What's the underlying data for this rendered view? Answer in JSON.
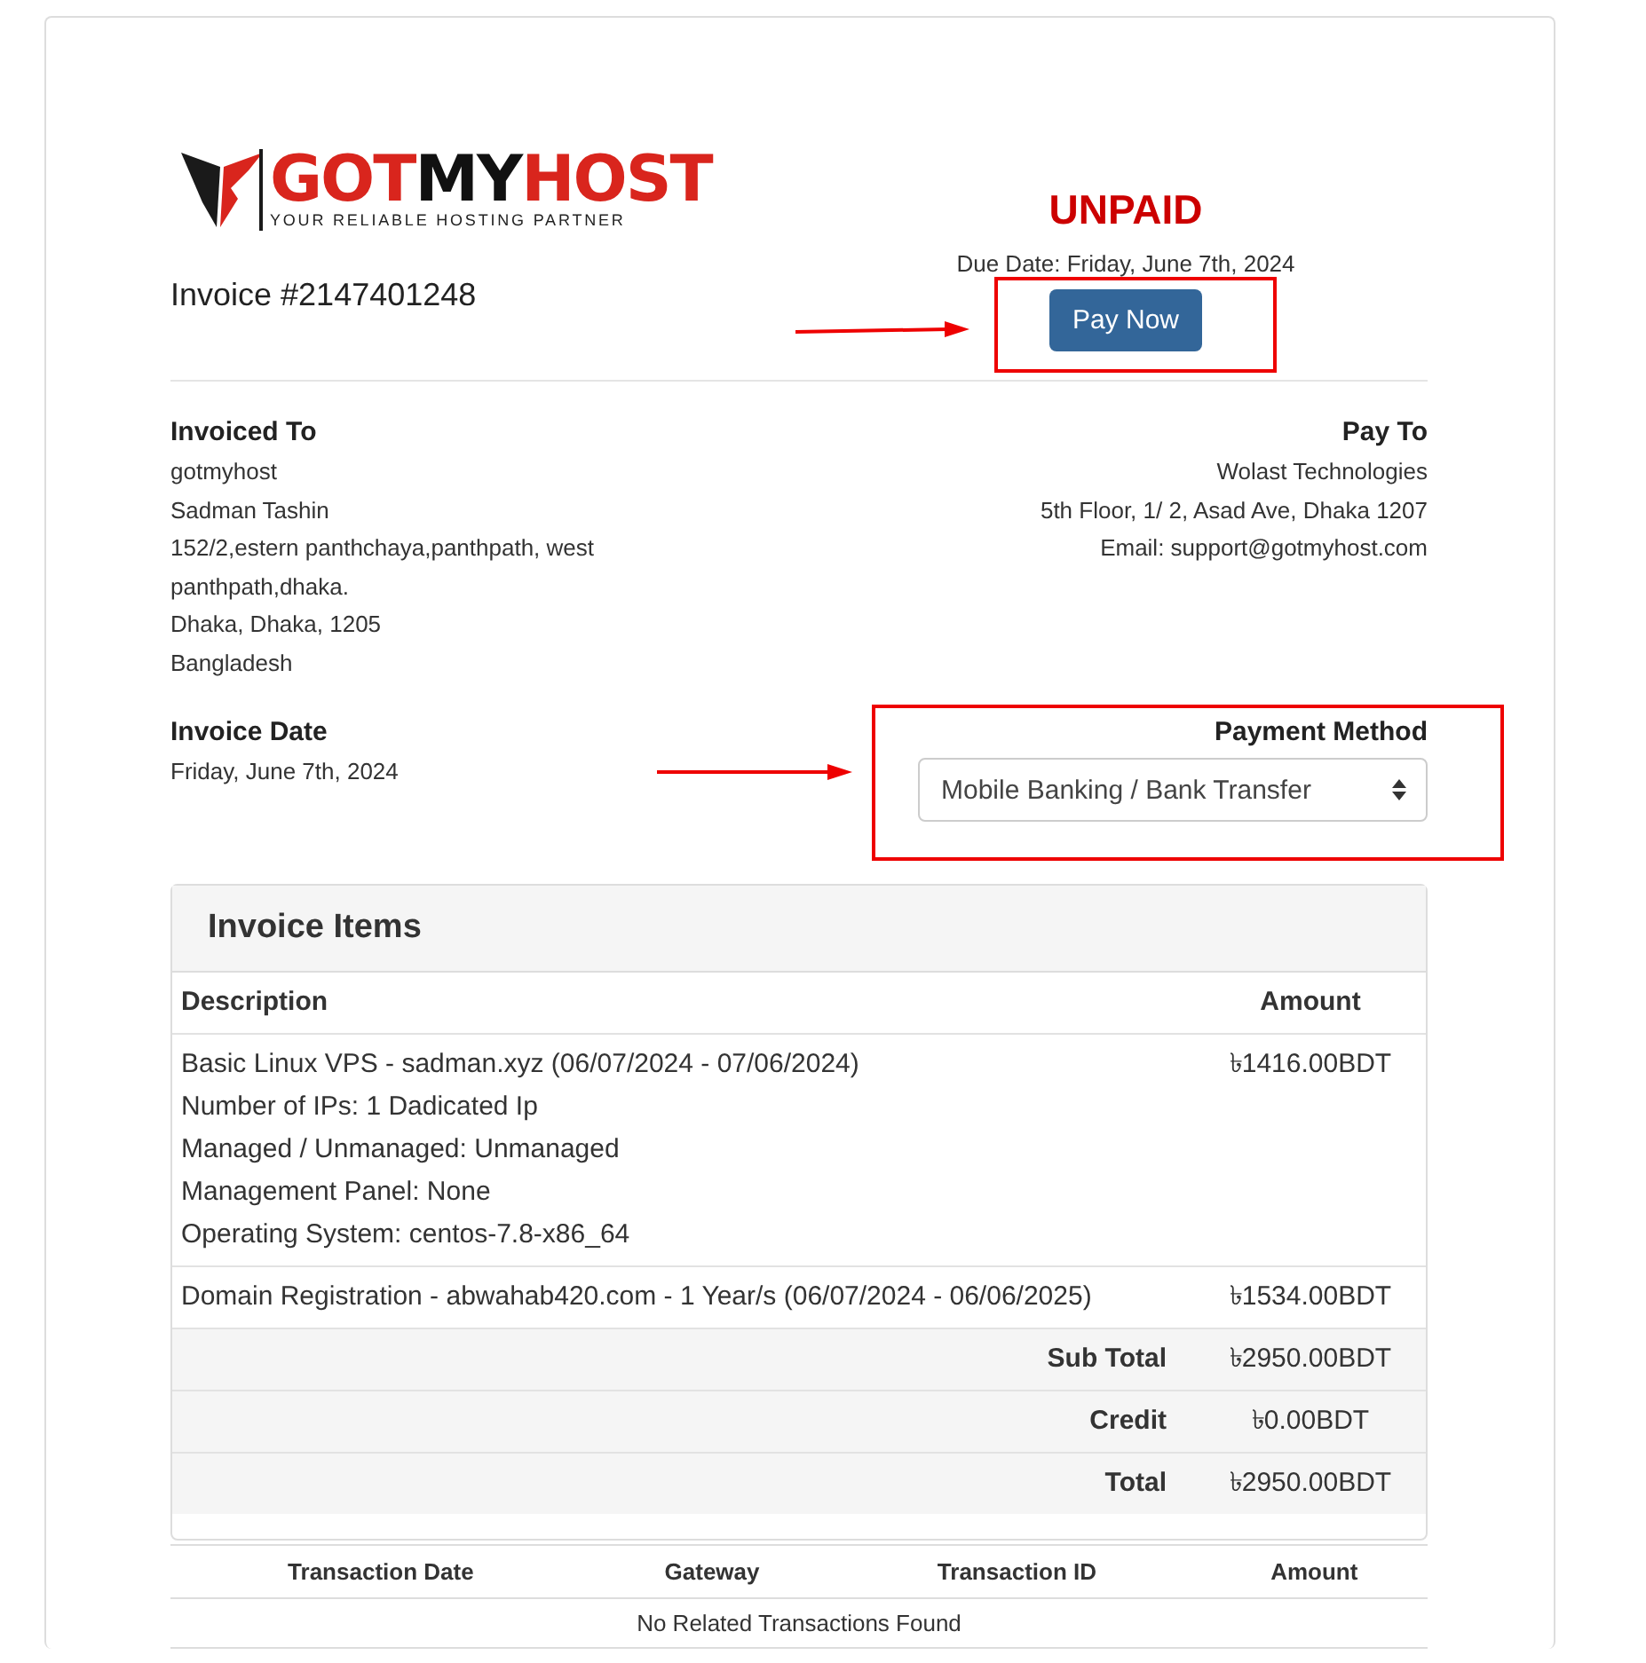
{
  "logo": {
    "parts": [
      {
        "text": "GOT",
        "color": "#d9251d"
      },
      {
        "text": "MY",
        "color": "#111111"
      },
      {
        "text": "HOST",
        "color": "#d9251d"
      }
    ],
    "tagline": "YOUR RELIABLE HOSTING PARTNER"
  },
  "invoice_title": "Invoice #2147401248",
  "status": {
    "label": "UNPAID",
    "due_date": "Due Date: Friday, June 7th, 2024",
    "button": "Pay Now"
  },
  "invoiced_to": {
    "heading": "Invoiced To",
    "lines": [
      "gotmyhost",
      "Sadman Tashin",
      "152/2,estern panthchaya,panthpath, west panthpath,dhaka.",
      "Dhaka, Dhaka, 1205",
      "Bangladesh"
    ]
  },
  "pay_to": {
    "heading": "Pay To",
    "lines": [
      "Wolast Technologies",
      "5th Floor, 1/ 2, Asad Ave, Dhaka 1207",
      "Email: support@gotmyhost.com"
    ]
  },
  "invoice_date": {
    "heading": "Invoice Date",
    "value": "Friday, June 7th, 2024"
  },
  "payment_method": {
    "heading": "Payment Method",
    "value": "Mobile Banking / Bank Transfer"
  },
  "items_panel": {
    "title": "Invoice Items",
    "columns": [
      "Description",
      "Amount"
    ],
    "rows": [
      {
        "lines": [
          "Basic Linux VPS - sadman.xyz (06/07/2024 - 07/06/2024)",
          "Number of IPs: 1 Dadicated Ip",
          "Managed / Unmanaged: Unmanaged",
          "Management Panel: None",
          "Operating System: centos-7.8-x86_64"
        ],
        "amount": "৳1416.00BDT"
      },
      {
        "lines": [
          "Domain Registration - abwahab420.com - 1 Year/s (06/07/2024 - 06/06/2025)"
        ],
        "amount": "৳1534.00BDT"
      }
    ],
    "totals": [
      {
        "label": "Sub Total",
        "amount": "৳2950.00BDT"
      },
      {
        "label": "Credit",
        "amount": "৳0.00BDT"
      },
      {
        "label": "Total",
        "amount": "৳2950.00BDT"
      }
    ]
  },
  "transactions": {
    "columns": [
      "Transaction Date",
      "Gateway",
      "Transaction ID",
      "Amount"
    ],
    "empty": "No Related Transactions Found"
  }
}
